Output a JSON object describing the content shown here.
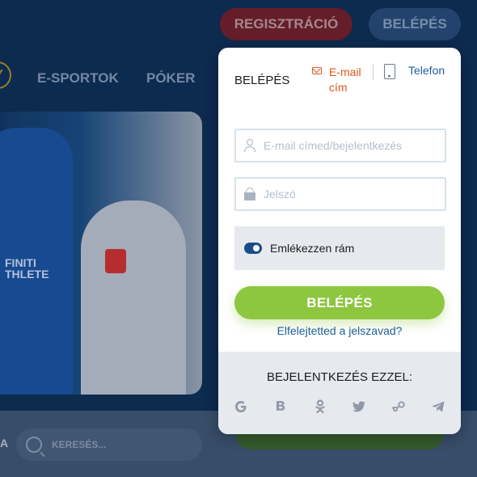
{
  "header": {
    "register_label": "REGISZTRÁCIÓ",
    "login_label": "BELÉPÉS"
  },
  "nav": {
    "items": [
      {
        "label": "E-SPORTOK"
      },
      {
        "label": "PÓKER"
      }
    ],
    "ring_glyph": "Y"
  },
  "hero": {
    "shirt_text": "FINITI\nTHLETE"
  },
  "bottom": {
    "partial_label": "A",
    "search_placeholder": "KERESÉS..."
  },
  "login_panel": {
    "title": "BELÉPÉS",
    "tab_email_label": "E-mail cím",
    "tab_phone_label": "Telefon",
    "email_placeholder": "E-mail címed/bejelentkezés",
    "password_placeholder": "Jelszó",
    "remember_label": "Emlékezzen rám",
    "remember_checked": true,
    "login_button": "BELÉPÉS",
    "forgot_link": "Elfelejtetted a jelszavad?",
    "social_title": "BEJELENTKEZÉS EZZEL:",
    "social_icons": [
      "google-icon",
      "b-icon",
      "odnoklassniki-icon",
      "twitter-icon",
      "steam-icon",
      "telegram-icon"
    ]
  },
  "colors": {
    "accent_orange": "#e0561b",
    "link_blue": "#1d5f9a",
    "login_green": "#8dc63f",
    "toggle_blue": "#1a4d88",
    "page_bg": "#0f2f57"
  }
}
